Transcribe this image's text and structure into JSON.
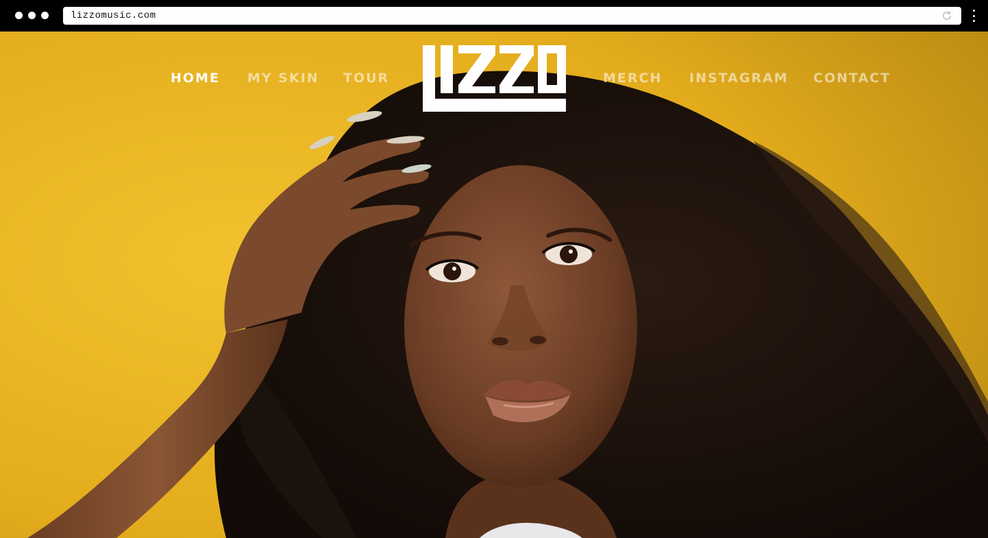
{
  "browser": {
    "url": "lizzomusic.com",
    "window_buttons": [
      "dot",
      "dot",
      "dot"
    ],
    "reload_icon": "reload-icon",
    "menu_icon": "kebab-menu-icon"
  },
  "site": {
    "logo_text": "LIZZO",
    "nav": {
      "home": "HOME",
      "my_skin": "MY SKIN",
      "tour": "TOUR",
      "merch": "MERCH",
      "instagram": "INSTAGRAM",
      "contact": "CONTACT"
    },
    "active_nav": "home"
  },
  "colors": {
    "background_yellow": "#e9b422",
    "hair": "#1a110c",
    "skin": "#7a4a30",
    "nav_active": "#ffffff",
    "nav_inactive": "rgba(255,255,255,0.55)"
  }
}
